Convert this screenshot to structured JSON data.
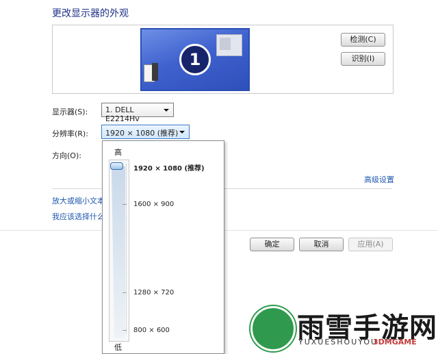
{
  "page": {
    "title": "更改显示器的外观"
  },
  "preview": {
    "monitor_number": "1"
  },
  "buttons": {
    "detect": "检测(C)",
    "identify": "识别(I)",
    "ok": "确定",
    "cancel": "取消",
    "apply": "应用(A)"
  },
  "fields": {
    "display_label": "显示器(S):",
    "display_value": "1. DELL E2214Hv",
    "resolution_label": "分辨率(R):",
    "resolution_value": "1920 × 1080 (推荐)",
    "orientation_label": "方向(O):"
  },
  "links": {
    "advanced": "高级设置",
    "text_size": "放大或缩小文本",
    "which_settings": "我应该选择什么"
  },
  "resolution_dropdown": {
    "high": "高",
    "low": "低",
    "options": [
      "1920 × 1080 (推荐)",
      "1600 × 900",
      "1280 × 720",
      "800 × 600"
    ],
    "selected_index": 0
  },
  "watermark": {
    "title": "雨雪手游网",
    "subtitle": "YUXUESHOUYOU",
    "extra": "3DMGAME"
  }
}
